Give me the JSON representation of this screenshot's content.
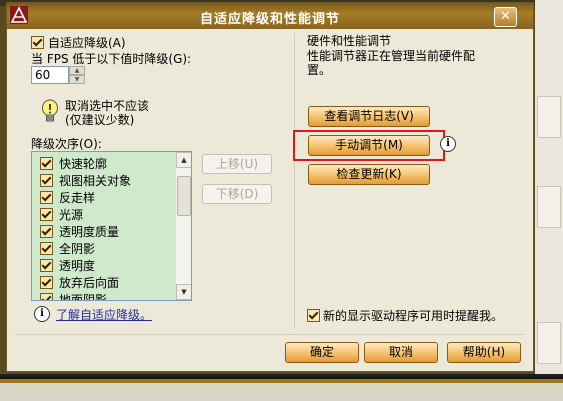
{
  "window": {
    "title": "自适应降级和性能调节",
    "close_symbol": "✕"
  },
  "left": {
    "adaptive_checkbox": {
      "label": "自适应降级(A)",
      "checked": true
    },
    "fps_label": "当 FPS 低于以下值时降级(G):",
    "fps_value": "60",
    "warning_line1": "取消选中不应该",
    "warning_line2": "(仅建议少数)",
    "order_label": "降级次序(O):",
    "order_items": [
      {
        "label": "快速轮廓",
        "checked": true
      },
      {
        "label": "视图相关对象",
        "checked": true
      },
      {
        "label": "反走样",
        "checked": true
      },
      {
        "label": "光源",
        "checked": true
      },
      {
        "label": "透明度质量",
        "checked": true
      },
      {
        "label": "全阴影",
        "checked": true
      },
      {
        "label": "透明度",
        "checked": true
      },
      {
        "label": "放弃后向面",
        "checked": true
      },
      {
        "label": "地面阴影",
        "checked": true
      }
    ],
    "move_up": "上移(U)",
    "move_down": "下移(D)",
    "learn_link": "了解自适应降级。"
  },
  "right": {
    "group_title": "硬件和性能调节",
    "description_line1": "性能调节器正在管理当前硬件配",
    "description_line2": "置。",
    "view_log_button": "查看调节日志(V)",
    "manual_tune_button": "手动调节(M)",
    "check_update_button": "检查更新(K)",
    "notify_checkbox": {
      "label": "新的显示驱动程序可用时提醒我。",
      "checked": true
    }
  },
  "footer": {
    "ok": "确定",
    "cancel": "取消",
    "help": "帮助(H)"
  }
}
